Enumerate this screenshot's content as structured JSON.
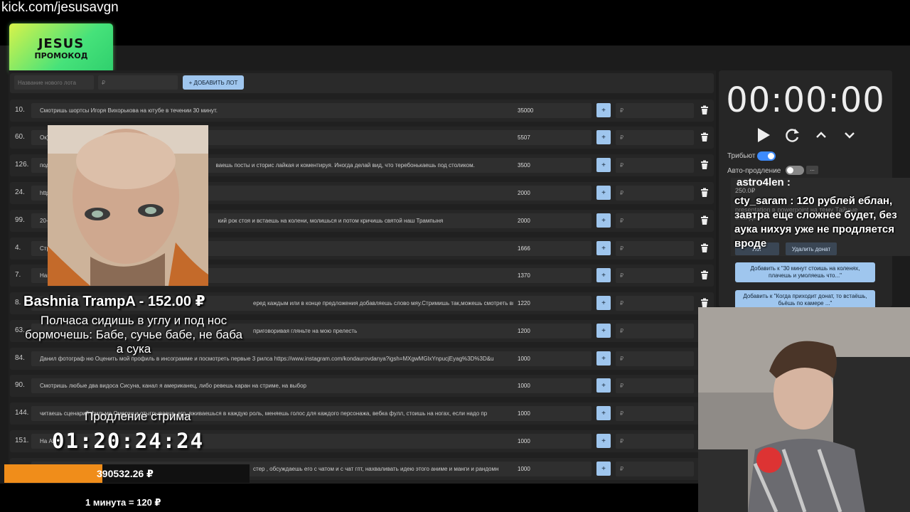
{
  "stream": {
    "url": "kick.com/jesusavgn"
  },
  "promo": {
    "line1": "JESUS",
    "line2": "ПРОМОКОД"
  },
  "add_lot": {
    "name_placeholder": "Название нового лота",
    "sum_placeholder": "₽",
    "button_label": "+ ДОБАВИТЬ ЛОТ"
  },
  "lots": [
    {
      "num": "10.",
      "text": "Смотришь шортсы Игоря Вихорькова на ютубе в течении 30 минут.",
      "amount": "35000",
      "plus": "+",
      "rub": "₽"
    },
    {
      "num": "60.",
      "text": "Ок) Р",
      "amount": "5507",
      "plus": "+",
      "rub": "₽"
    },
    {
      "num": "126.",
      "text": "подп",
      "text2": "ваешь посты и сторис лайкая и коментируя. Иногда делай вид, что теребонькаешь под столиком.",
      "amount": "3500",
      "plus": "+",
      "rub": "₽"
    },
    {
      "num": "24.",
      "text": "https://",
      "amount": "2000",
      "plus": "+",
      "rub": "₽"
    },
    {
      "num": "99.",
      "text": "20-40",
      "text2": "кий рок стоя и встаешь на колени, молишься и потом кричишь святой наш Трампыня",
      "amount": "2000",
      "plus": "+",
      "rub": "₽"
    },
    {
      "num": "4.",
      "text": "Стрим",
      "amount": "1666",
      "plus": "+",
      "rub": "₽"
    },
    {
      "num": "7.",
      "text": "Нам ну",
      "amount": "1370",
      "plus": "+",
      "rub": "₽"
    },
    {
      "num": "8.",
      "text": "",
      "text2": "еред каждым или в конце предложения добавляешь слово мяу.Стримишь так,можешь смотреть ви",
      "amount": "1220",
      "plus": "+",
      "rub": "₽"
    },
    {
      "num": "63.",
      "text": "",
      "text2": "приговоривая гляньте на мою прелесть",
      "amount": "1200",
      "plus": "+",
      "rub": "₽"
    },
    {
      "num": "84.",
      "text": "Данил фотограф ню Оценить мой профиль в инсограмме и посмотреть первые 3 рилса https://www.instagram.com/kondaurovdanya?igsh=MXgwMGlxYnpucjEyag%3D%3D&u",
      "amount": "1000",
      "plus": "+",
      "rub": "₽"
    },
    {
      "num": "90.",
      "text": "Смотришь любые два видоса Сисуна, канал я американец, либо ревешь каран на стриме, на выбор",
      "amount": "1000",
      "plus": "+",
      "rub": "₽"
    },
    {
      "num": "144.",
      "text": "читаешь сценарий фильма Омерзи и отыгрываешь его, вживаешься в каждую роль, меняешь голос для каждого персонажа, вебка фулл, стоишь на ногах, если надо пр",
      "amount": "1000",
      "plus": "+",
      "rub": "₽"
    },
    {
      "num": "151.",
      "text": "На АР",
      "amount": "1000",
      "plus": "+",
      "rub": "₽"
    },
    {
      "num": "",
      "text": "",
      "text2": "стер , обсуждаешь его с чатом и с чат гпт, нахваливать идею этого аниме и манги и рандомн",
      "amount": "1000",
      "plus": "+",
      "rub": "₽"
    }
  ],
  "timer_panel": {
    "time": "00:00:00",
    "tribute_label": "Трибьют",
    "auto_extend_label": "Авто-продление",
    "more_label": "...",
    "colors": {
      "toggle_on": "#3d8bfd",
      "toggle_off": "#888888"
    }
  },
  "donation_card": {
    "user": "astro4len :",
    "sum": "250.0₽",
    "faint_text": "presentation в powerpoint на тему Тайные слайдов",
    "chat_message": "cty_saram : 120 рублей еблан, завтра еще сложнее будет, без аука нихуя уже не продляется вроде",
    "btn_lot": "Лот",
    "btn_delete": "Удалить донат",
    "btn_add1": "Добавить к \"30 минут стоишь на коленях, плачешь и умоляешь что...\"",
    "btn_add2": "Добавить к \"Когда приходит донат, то встаёшь, бьёшь по камере ...\""
  },
  "alert": {
    "title": "Bashnia TrampA - 152.00 ₽",
    "message": "Полчаса сидишь в углу и под нос бормочешь: Бабе, сучье бабе, не баба а сука"
  },
  "extension": {
    "label": "Продление стрима",
    "time": "01:20:24:24",
    "total": "390532.26 ₽",
    "progress_fraction": 0.4,
    "rate": "1 минута = 120 ₽",
    "colors": {
      "progress": "#f08d1a"
    }
  }
}
